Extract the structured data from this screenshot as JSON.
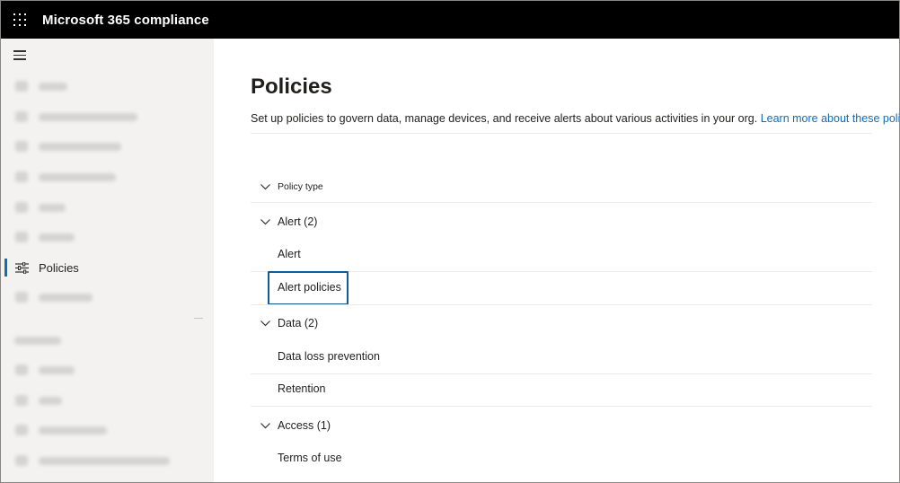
{
  "app": {
    "title": "Microsoft 365 compliance"
  },
  "sidebar": {
    "active_label": "Policies"
  },
  "page": {
    "title": "Policies",
    "description": "Set up policies to govern data, manage devices, and receive alerts about various activities in your org.",
    "learn_more": "Learn more about these policies"
  },
  "list": {
    "header": "Policy type",
    "groups": [
      {
        "label": "Alert (2)",
        "items": [
          "Alert",
          "Alert policies"
        ]
      },
      {
        "label": "Data (2)",
        "items": [
          "Data loss prevention",
          "Retention"
        ]
      },
      {
        "label": "Access (1)",
        "items": [
          "Terms of use"
        ]
      }
    ]
  },
  "colors": {
    "accent": "#0f6cbd",
    "topbar": "#000000",
    "sidebar": "#f3f2f1",
    "focus": "#0f5c99"
  }
}
